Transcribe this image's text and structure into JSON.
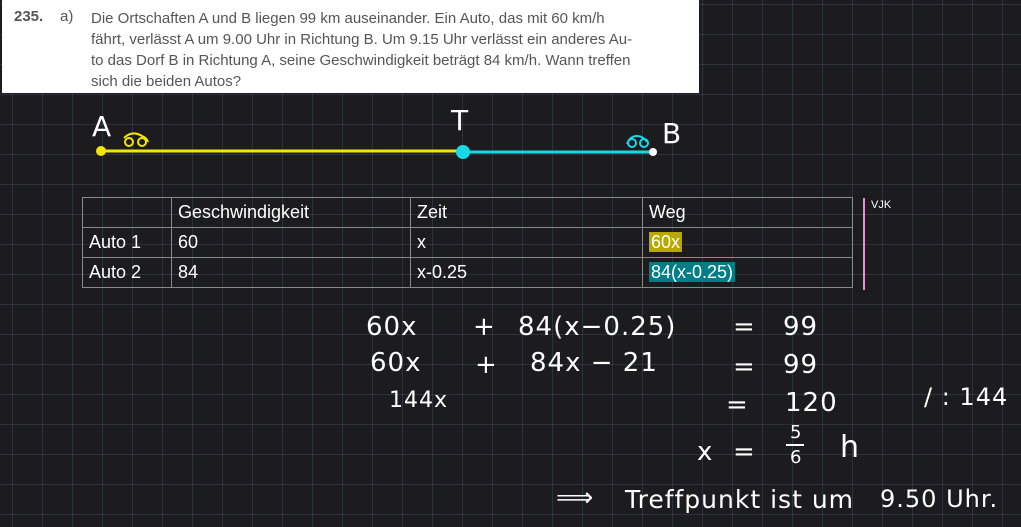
{
  "problem": {
    "number": "235.",
    "part": "a)",
    "lines": [
      "Die Ortschaften A und B liegen 99 km auseinander. Ein Auto, das mit 60 km/h",
      "fährt, verlässt A um 9.00 Uhr in Richtung B. Um 9.15 Uhr verlässt ein anderes Au-",
      "to das Dorf B in Richtung A, seine Geschwindigkeit beträgt 84 km/h. Wann treffen",
      "sich die beiden Autos?"
    ]
  },
  "sketch": {
    "label_a": "A",
    "label_t": "T",
    "label_b": "B",
    "colors": {
      "auto1": "#f2e600",
      "auto2": "#19d8e6",
      "divider": "#e78fd6"
    }
  },
  "table": {
    "headers": [
      "",
      "Geschwindigkeit",
      "Zeit",
      "Weg"
    ],
    "rows": [
      [
        "Auto 1",
        "60",
        "x",
        "60x"
      ],
      [
        "Auto 2",
        "84",
        "x-0.25",
        "84(x-0.25)"
      ]
    ]
  },
  "side_label": "VJK",
  "work": {
    "line1_left": "60x",
    "line1_plus": "+",
    "line1_term": "84(x−0.25)",
    "line1_eq": "=",
    "line1_rhs": "99",
    "line2_left": "60x",
    "line2_plus": "+",
    "line2_term": "84x − 21",
    "line2_eq": "=",
    "line2_rhs": "99",
    "line3_left": "144x",
    "line3_eq": "=",
    "line3_rhs": "120",
    "op": "/ : 144",
    "line4_x": "x",
    "line4_eq": "=",
    "line4_num": "5",
    "line4_den": "6",
    "line4_unit": "h",
    "answer_arrow": "⟹",
    "answer_text": "Treffpunkt ist um",
    "answer_time": "9.50 Uhr."
  }
}
